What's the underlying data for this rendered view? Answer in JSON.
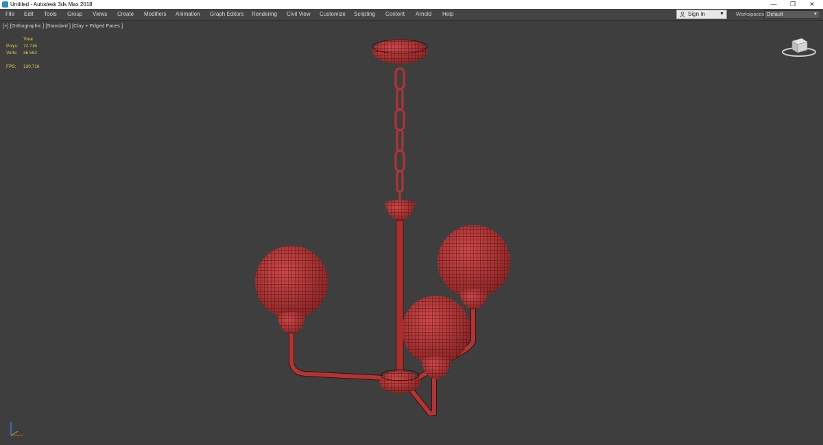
{
  "window": {
    "title": "Untitled - Autodesk 3ds Max 2018",
    "controls": {
      "minimize": "—",
      "maximize": "❐",
      "close": "✕"
    }
  },
  "menu": [
    "File",
    "Edit",
    "Tools",
    "Group",
    "Views",
    "Create",
    "Modifiers",
    "Animation",
    "Graph Editors",
    "Rendering",
    "Civil View",
    "Customize",
    "Scripting",
    "Content",
    "Arnold",
    "Help"
  ],
  "account": {
    "sign_in": "Sign In",
    "caret": "▼"
  },
  "workspaces": {
    "label": "Workspaces:",
    "value": "Default",
    "caret": "▼"
  },
  "viewport": {
    "label": "[+] [Orthographic ] [Standard ] [Clay + Edged Faces ]",
    "stats": {
      "header": "Total",
      "polys_label": "Polys:",
      "polys_value": "72 716",
      "verts_label": "Verts:",
      "verts_value": "36 552",
      "fps_label": "FPS:",
      "fps_value": "130,716"
    },
    "model_color": "#b13535",
    "background": "#3e3e3e"
  },
  "icons": {
    "app": "3ds-max-icon",
    "user": "user-icon",
    "viewcube": "viewcube-icon",
    "axis": "axis-gizmo-icon"
  }
}
